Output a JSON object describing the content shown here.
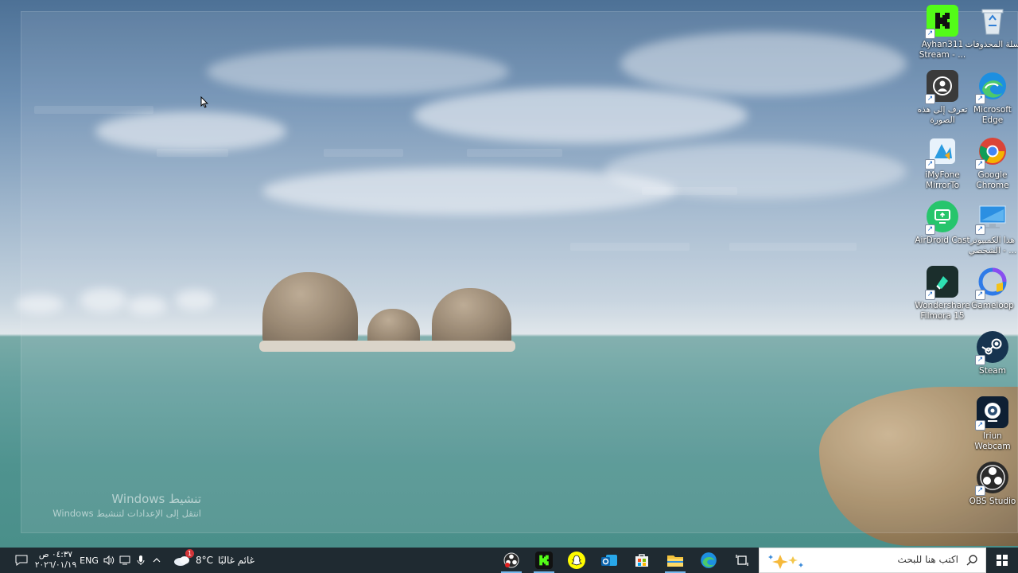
{
  "desktop": {
    "icons": [
      {
        "id": "recycle-bin",
        "label": "سلة المحذوفات",
        "icon": "recycle-bin-icon"
      },
      {
        "id": "ayhan-stream",
        "label": "Ayhan311 Stream - ...",
        "icon": "kick-app-icon"
      },
      {
        "id": "microsoft-edge",
        "label": "Microsoft Edge",
        "icon": "edge-icon"
      },
      {
        "id": "identify-photo",
        "label": "تعرف إلى هذه الصورة",
        "icon": "identify-photo-icon"
      },
      {
        "id": "google-chrome",
        "label": "Google Chrome",
        "icon": "chrome-icon"
      },
      {
        "id": "imyfone-mirrorto",
        "label": "iMyFone MirrorTo",
        "icon": "imyfone-icon"
      },
      {
        "id": "this-pc",
        "label": "هذا الكمبيوتر الشخصي - ...",
        "icon": "monitor-icon"
      },
      {
        "id": "airdroid-cast",
        "label": "AirDroid Cast",
        "icon": "airdroid-cast-icon"
      },
      {
        "id": "gameloop",
        "label": "Gameloop",
        "icon": "gameloop-icon"
      },
      {
        "id": "filmora",
        "label": "Wondershare Filmora 15",
        "icon": "filmora-icon"
      },
      {
        "id": "steam",
        "label": "Steam",
        "icon": "steam-icon"
      },
      {
        "id": "iriun-webcam",
        "label": "Iriun Webcam",
        "icon": "webcam-icon"
      },
      {
        "id": "obs-studio",
        "label": "OBS Studio",
        "icon": "obs-icon"
      }
    ],
    "watermark": {
      "title": "تنشيط Windows",
      "subtitle": "انتقل إلى الإعدادات لتنشيط Windows"
    }
  },
  "taskbar": {
    "search_placeholder": "اكتب هنا للبحث",
    "weather": {
      "temperature": "8°C",
      "condition": "غائم غالبًا",
      "alert_badge": "1"
    },
    "language": "ENG",
    "clock": {
      "time": "٠٤:٣٧ ص",
      "date": "٢٠٢٦/٠١/١٩"
    },
    "pinned_apps": [
      {
        "id": "obs",
        "icon": "obs-recording-icon"
      },
      {
        "id": "kick",
        "icon": "kick-app-icon"
      },
      {
        "id": "snapchat",
        "icon": "snapchat-icon"
      },
      {
        "id": "outlook",
        "icon": "outlook-icon"
      },
      {
        "id": "store",
        "icon": "store-icon"
      },
      {
        "id": "file-explorer",
        "icon": "folder-icon"
      },
      {
        "id": "edge",
        "icon": "edge-icon"
      }
    ]
  },
  "colors": {
    "taskbar_bg": "#1f2a31",
    "accent_underline": "#76b9ed",
    "kick_green": "#53fc18"
  }
}
